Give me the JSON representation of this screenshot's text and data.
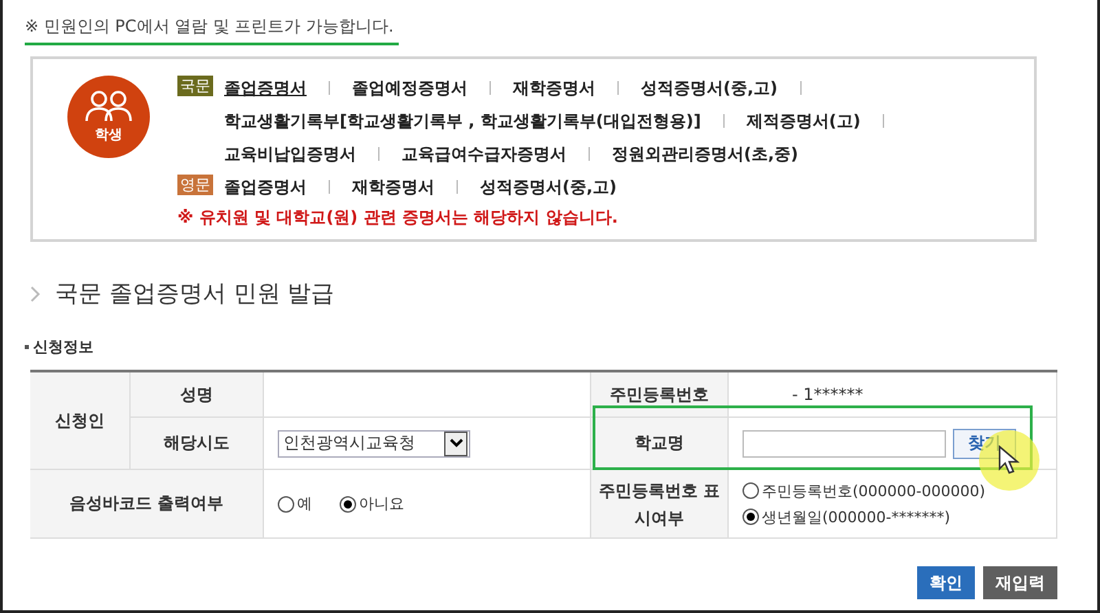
{
  "notice": "※ 민원인의 PC에서 열람 및 프린트가 가능합니다.",
  "certificate_menu": {
    "icon_label": "학생",
    "groups": [
      {
        "label": "국문",
        "color": "#6b6b1e",
        "lines": [
          [
            {
              "text": "졸업증명서",
              "selected": true
            },
            {
              "text": "졸업예정증명서",
              "selected": false
            },
            {
              "text": "재학증명서",
              "selected": false
            },
            {
              "text": "성적증명서(중,고)",
              "selected": false
            }
          ],
          [
            {
              "text": "학교생활기록부[학교생활기록부 , 학교생활기록부(대입전형용)]",
              "selected": false
            },
            {
              "text": "제적증명서(고)",
              "selected": false
            }
          ],
          [
            {
              "text": "교육비납입증명서",
              "selected": false
            },
            {
              "text": "교육급여수급자증명서",
              "selected": false
            },
            {
              "text": "정원외관리증명서(초,중)",
              "selected": false
            }
          ]
        ]
      },
      {
        "label": "영문",
        "color": "#c8733a",
        "lines": [
          [
            {
              "text": "졸업증명서",
              "selected": false
            },
            {
              "text": "재학증명서",
              "selected": false
            },
            {
              "text": "성적증명서(중,고)",
              "selected": false
            }
          ]
        ]
      }
    ],
    "warning": "※ 유치원 및 대학교(원) 관련 증명서는 해당하지 않습니다."
  },
  "form": {
    "title": "국문 졸업증명서 민원 발급",
    "section": "신청정보",
    "applicant_label": "신청인",
    "name_label": "성명",
    "id_label": "주민등록번호",
    "id_value": "- 1******",
    "region_label": "해당시도",
    "region_select": "인천광역시교육청",
    "school_label": "학교명",
    "school_highlighted": true,
    "search_button": "찾기",
    "barcode_label": "음성바코드 출력여부",
    "barcode_options": [
      {
        "label": "예",
        "selected": false
      },
      {
        "label": "아니요",
        "selected": true
      }
    ],
    "id_display_label": "주민등록번호 표시여부",
    "id_display_options": [
      {
        "label": "주민등록번호(000000-000000)",
        "selected": false
      },
      {
        "label": "생년월일(000000-*******)",
        "selected": true
      }
    ]
  },
  "buttons": [
    {
      "label": "확인",
      "kind": "primary"
    },
    {
      "label": "재입력",
      "kind": "secondary"
    }
  ]
}
